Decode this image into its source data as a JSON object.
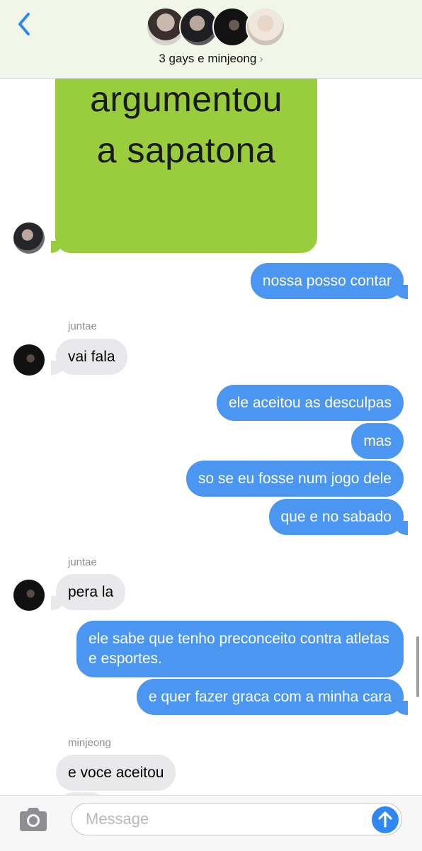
{
  "header": {
    "group_name": "3 gays e minjeong",
    "chevron": "›",
    "back_icon": "chevron-left-icon"
  },
  "messages": {
    "image_meme_line1": "argumentou",
    "image_meme_line2": "a sapatona",
    "m1": "nossa posso contar",
    "sender1": "juntae",
    "m2": "vai fala",
    "m3": "ele aceitou as desculpas",
    "m4": "mas",
    "m5": "so se eu fosse num jogo dele",
    "m6": "que e no sabado",
    "sender2": "juntae",
    "m7": "pera la",
    "m8": "ele sabe que tenho preconceito contra atletas e esportes.",
    "m9": "e quer fazer graca com a minha cara",
    "sender3": "minjeong",
    "m10": "e voce aceitou"
  },
  "input": {
    "placeholder": "Message",
    "camera_icon": "camera-icon",
    "send_icon": "arrow-up-icon"
  },
  "colors": {
    "outgoing": "#4b96f0",
    "incoming": "#e9e9eb",
    "image_bg": "#9acd3d",
    "header_bg": "#f2f6e9",
    "accent": "#2f87f2"
  }
}
